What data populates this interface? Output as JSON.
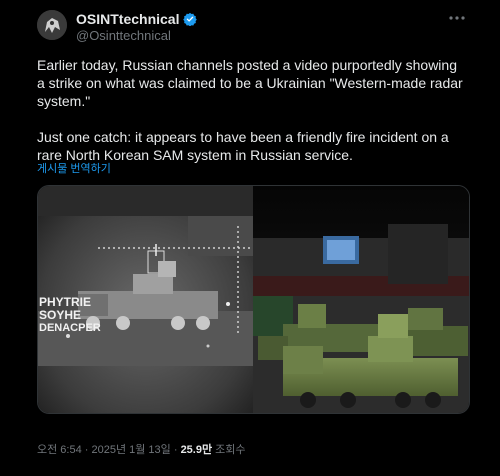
{
  "author": {
    "display_name": "OSINTtechnical",
    "handle": "@Osinttechnical",
    "verified_color": "#1d9bf0"
  },
  "tweet": {
    "paragraph1": "Earlier today, Russian channels posted a video purportedly showing a strike on what was claimed to be a Ukrainian \"Western-made radar system.\"",
    "paragraph2": "Just one catch: it appears to have been a friendly fire incident on a rare North Korean SAM system in Russian service.",
    "translate_link": "게시물 번역하기"
  },
  "media": {
    "left_overlay_text": [
      "PHYTRIE",
      "SOYHE",
      "DENACPER"
    ]
  },
  "meta": {
    "timestamp": "오전 6:54 · 2025년 1월 13일 · ",
    "views_count": "25.9만",
    "views_label": " 조회수"
  },
  "icons": {
    "more": "more-options-icon",
    "verified": "verified-badge-icon"
  }
}
